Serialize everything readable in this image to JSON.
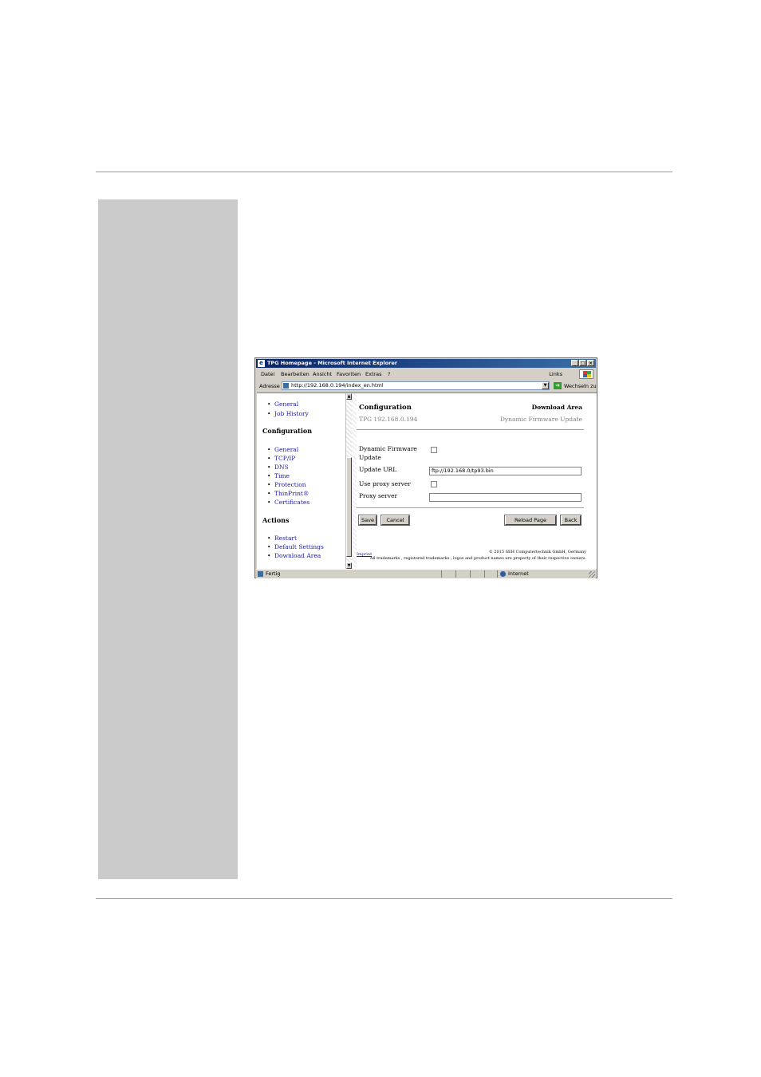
{
  "window": {
    "title": "TPG Homepage - Microsoft Internet Explorer",
    "controls": {
      "minimize": "_",
      "maximize": "□",
      "close": "×"
    }
  },
  "menu": {
    "items": [
      "Datei",
      "Bearbeiten",
      "Ansicht",
      "Favoriten",
      "Extras",
      "?"
    ],
    "links_label": "Links"
  },
  "address": {
    "label": "Adresse",
    "url": "http://192.168.0.194/index_en.html",
    "go_label": "Wechseln zu"
  },
  "nav": {
    "top_items": [
      "General",
      "Job History"
    ],
    "sections": [
      {
        "heading": "Configuration",
        "items": [
          "General",
          "TCP/IP",
          "DNS",
          "Time",
          "Protection",
          "ThinPrint®",
          "Certificates"
        ]
      },
      {
        "heading": "Actions",
        "items": [
          "Restart",
          "Default Settings",
          "Download Area"
        ]
      }
    ]
  },
  "main": {
    "title": "Configuration",
    "section": "Download Area",
    "device": "TPG 192.168.0.194",
    "subsection": "Dynamic Firmware Update",
    "fields": {
      "dynamic_firmware_label_1": "Dynamic Firmware",
      "dynamic_firmware_label_2": "Update",
      "dynamic_firmware_checked": false,
      "update_url_label": "Update URL",
      "update_url_value": "ftp://192.168.0/tp93.bin",
      "use_proxy_label": "Use proxy server",
      "use_proxy_checked": false,
      "proxy_server_label": "Proxy server",
      "proxy_server_value": ""
    },
    "buttons": {
      "save": "Save",
      "cancel": "Cancel",
      "reload": "Reload Page",
      "back": "Back"
    },
    "footer": {
      "imprint": "Imprint",
      "copyright": "© 2015 SEH Computertechnik GmbH, Germany",
      "trademarks": "All trademarks , registered trademarks , logos and product names are property of their respective owners."
    }
  },
  "status": {
    "text": "Fertig",
    "zone": "Internet"
  }
}
